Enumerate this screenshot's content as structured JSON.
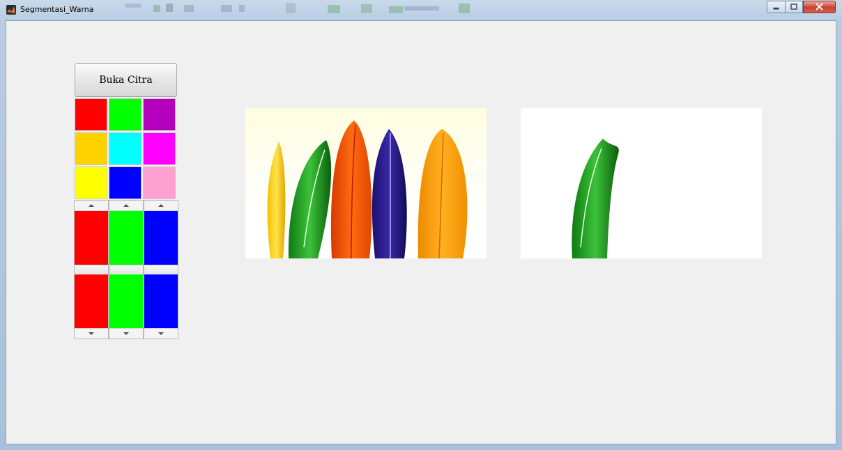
{
  "window": {
    "title": "Segmentasi_Warna"
  },
  "controls": {
    "open_button_label": "Buka Citra"
  },
  "palette": {
    "swatches": [
      {
        "name": "red",
        "color": "#ff0000"
      },
      {
        "name": "green",
        "color": "#00ff00"
      },
      {
        "name": "purple",
        "color": "#b400be"
      },
      {
        "name": "gold",
        "color": "#ffd200"
      },
      {
        "name": "cyan",
        "color": "#00ffff"
      },
      {
        "name": "magenta",
        "color": "#ff00ff"
      },
      {
        "name": "yellow",
        "color": "#ffff00"
      },
      {
        "name": "blue",
        "color": "#0000ff"
      },
      {
        "name": "pink",
        "color": "#ffa0d2"
      }
    ]
  },
  "sliders": [
    {
      "channel": "red",
      "color": "#ff0000"
    },
    {
      "channel": "green",
      "color": "#00ff00"
    },
    {
      "channel": "blue",
      "color": "#0000ff"
    }
  ],
  "images": {
    "original": "feathers-original",
    "result": "feathers-green-segmented"
  }
}
